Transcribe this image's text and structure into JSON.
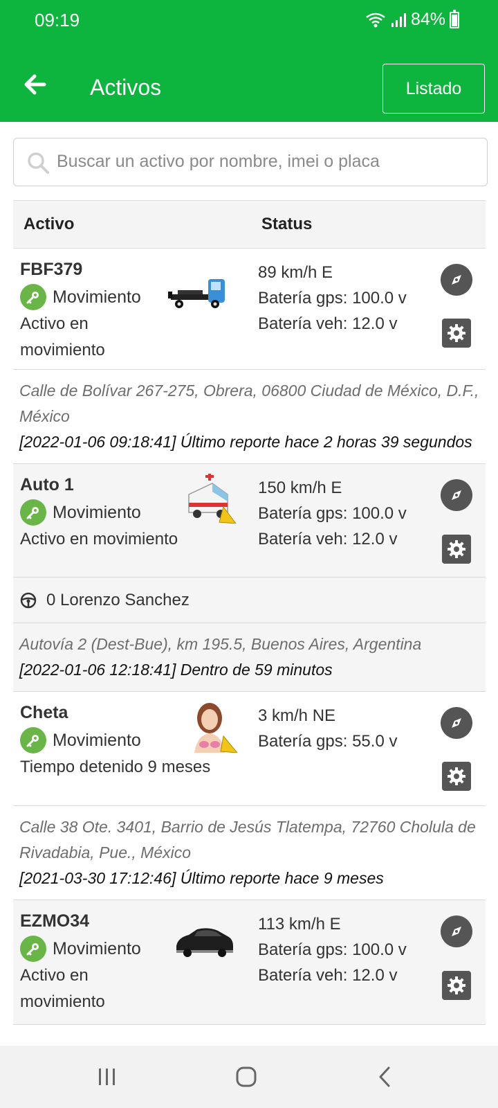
{
  "status_bar": {
    "time": "09:19",
    "battery": "84%"
  },
  "app_bar": {
    "title": "Activos",
    "action_label": "Listado"
  },
  "search": {
    "placeholder": "Buscar un activo por nombre, imei o placa"
  },
  "table": {
    "col_asset": "Activo",
    "col_status": "Status"
  },
  "assets": [
    {
      "name": "FBF379",
      "state": "Movimiento",
      "desc": "Activo en movimiento",
      "icon": "tow-truck-icon",
      "stats": [
        "89 km/h E",
        "Batería gps: 100.0 v",
        "Batería veh: 12.0 v"
      ],
      "address": "Calle de Bolívar 267-275, Obrera, 06800 Ciudad de México, D.F., México",
      "report": "[2022-01-06 09:18:41] Último reporte hace 2 horas 39 segundos"
    },
    {
      "name": "Auto 1",
      "state": "Movimiento",
      "desc": "Activo en movimiento",
      "icon": "ambulance-icon",
      "stats": [
        "150 km/h E",
        "Batería gps: 100.0 v",
        "Batería veh: 12.0 v"
      ],
      "driver": "0 Lorenzo Sanchez",
      "address": "Autovía 2 (Dest-Bue), km 195.5, Buenos Aires, Argentina",
      "report": "[2022-01-06 12:18:41] Dentro de 59 minutos"
    },
    {
      "name": "Cheta",
      "state": "Movimiento",
      "desc": "Tiempo detenido 9 meses",
      "icon": "woman-icon",
      "stats": [
        "3 km/h NE",
        "Batería gps: 55.0 v"
      ],
      "address": "Calle 38 Ote. 3401, Barrio de Jesús Tlatempa, 72760 Cholula de Rivadabia, Pue., México",
      "report": "[2021-03-30 17:12:46] Último reporte hace 9 meses"
    },
    {
      "name": "EZMO34",
      "state": "Movimiento",
      "desc": "Activo en movimiento",
      "icon": "car-icon",
      "stats": [
        "113 km/h E",
        "Batería gps: 100.0 v",
        "Batería veh: 12.0 v"
      ]
    }
  ],
  "colors": {
    "primary": "#0db43d",
    "key_green": "#6ab547",
    "button_gray": "#555555"
  }
}
